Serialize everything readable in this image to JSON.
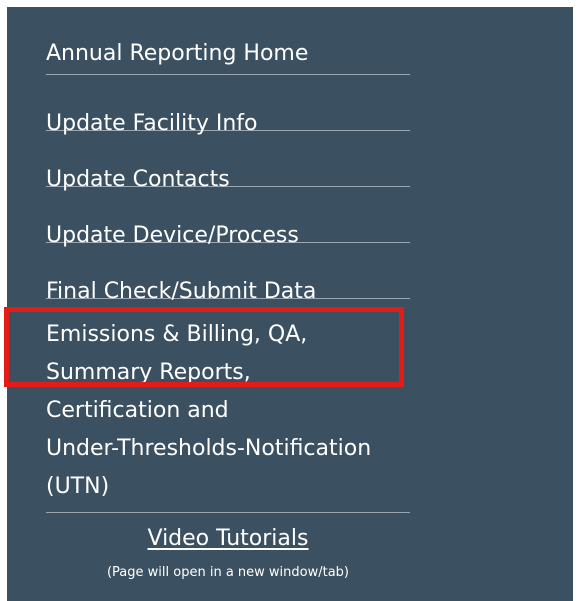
{
  "nav": {
    "items": [
      {
        "label": "Annual Reporting Home"
      },
      {
        "label": "Update Facility Info"
      },
      {
        "label": "Update Contacts"
      },
      {
        "label": "Update Device/Process"
      },
      {
        "label": "Final Check/Submit Data"
      },
      {
        "lines": [
          "Emissions & Billing, QA,",
          "Summary Reports,",
          "Certification and",
          "Under-Thresholds-Notification",
          "(UTN)"
        ]
      }
    ]
  },
  "footer": {
    "video_link": "Video Tutorials",
    "note": "(Page will open in a new window/tab)"
  },
  "colors": {
    "sidebar_bg": "#3b5060",
    "highlight": "#e41b17",
    "text": "#ffffff"
  }
}
